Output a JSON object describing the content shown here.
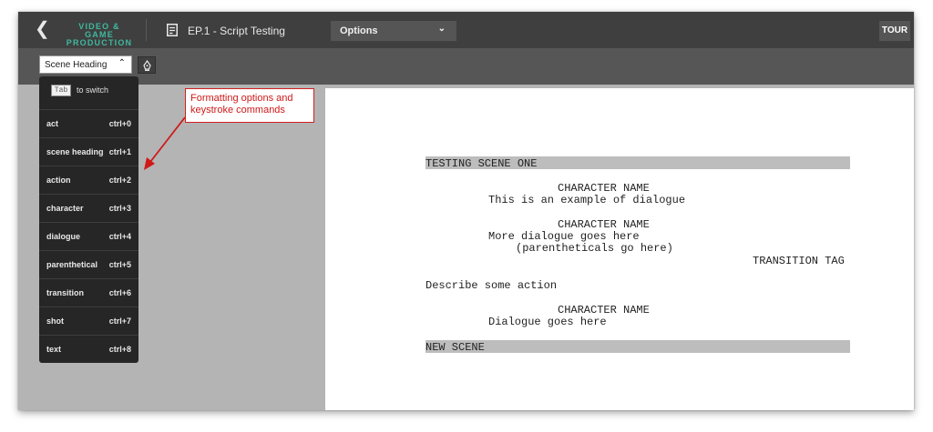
{
  "topbar": {
    "back_icon": "chevron-left-icon",
    "brand_line1": "VIDEO & GAME",
    "brand_line2": "PRODUCTION",
    "brand_color": "#3fb8a0",
    "doc_icon": "document-icon",
    "episode_title": "EP.1 - Script Testing",
    "options_label": "Options",
    "tour_label": "TOUR"
  },
  "toolbar": {
    "format_select_value": "Scene Heading",
    "format_select_icon": "chevron-up-icon",
    "pen_icon": "pen-nib-icon"
  },
  "format_menu": {
    "tab_key": "Tab",
    "tab_hint": "to switch",
    "items": [
      {
        "label": "act",
        "shortcut": "ctrl+0"
      },
      {
        "label": "scene heading",
        "shortcut": "ctrl+1"
      },
      {
        "label": "action",
        "shortcut": "ctrl+2"
      },
      {
        "label": "character",
        "shortcut": "ctrl+3"
      },
      {
        "label": "dialogue",
        "shortcut": "ctrl+4"
      },
      {
        "label": "parenthetical",
        "shortcut": "ctrl+5"
      },
      {
        "label": "transition",
        "shortcut": "ctrl+6"
      },
      {
        "label": "shot",
        "shortcut": "ctrl+7"
      },
      {
        "label": "text",
        "shortcut": "ctrl+8"
      }
    ]
  },
  "annotation": {
    "line1": "Formatting options and",
    "line2": "keystroke commands",
    "color": "#d01818"
  },
  "script": {
    "scene1": "TESTING SCENE ONE",
    "char1": "CHARACTER NAME",
    "dialogue1": "This is an example of dialogue",
    "char2": "CHARACTER NAME",
    "dialogue2": "More dialogue goes here",
    "parenthetical": "(parentheticals go here)",
    "transition": "TRANSITION TAG",
    "action": "Describe some action",
    "char3": "CHARACTER NAME",
    "dialogue3": "Dialogue goes here",
    "scene2": "NEW SCENE"
  }
}
